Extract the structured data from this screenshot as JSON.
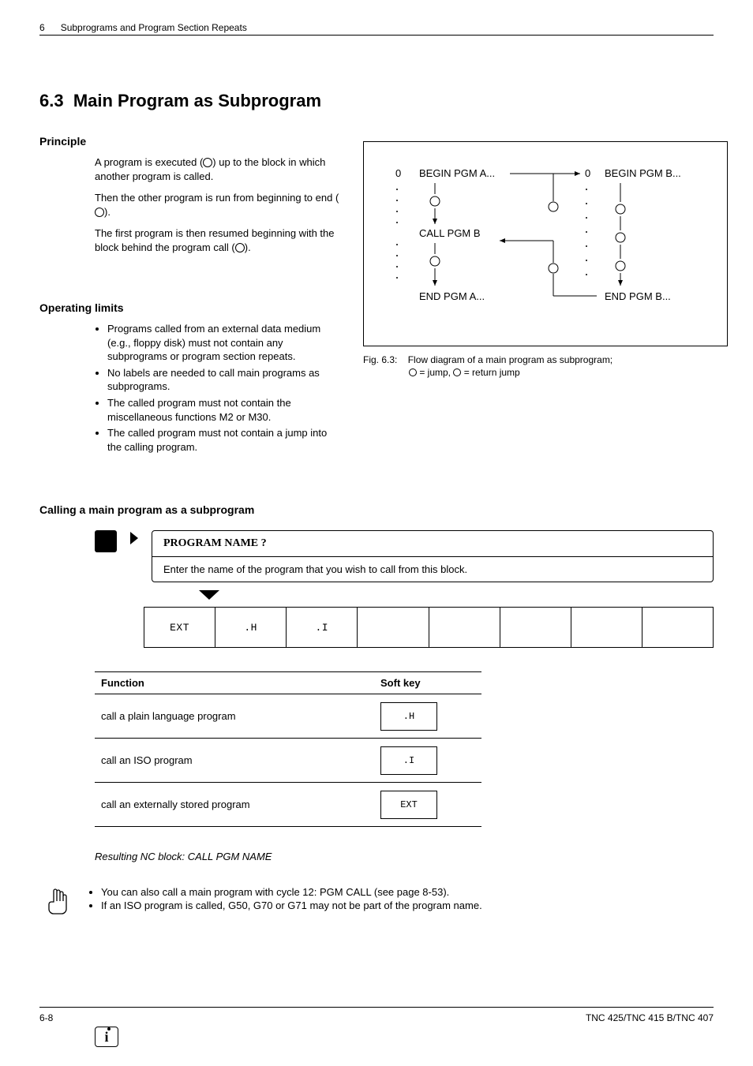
{
  "header": {
    "page_top": "6",
    "chapter": "Subprograms and Program Section Repeats"
  },
  "section": {
    "number": "6.3",
    "title": "Main Program as Subprogram"
  },
  "principle": {
    "heading": "Principle",
    "p1a": "A program is executed (",
    "p1b": ") up to the block in which another program is called.",
    "p2a": "Then the other program is run from beginning to end (",
    "p2b": ").",
    "p3a": "The first program is then resumed beginning with the block behind the program call (",
    "p3b": ")."
  },
  "limits": {
    "heading": "Operating limits",
    "items": [
      "Programs called from an external data medium (e.g., floppy disk) must not contain any subprograms or program section repeats.",
      "No labels are needed to call main programs as subprograms.",
      "The called program must not contain the miscellaneous functions M2 or M30.",
      "The called program must not contain a jump into the calling program."
    ]
  },
  "figure": {
    "left_0": "0",
    "begin_a": "BEGIN PGM A...",
    "call_b": "CALL PGM B",
    "end_a": "END PGM A...",
    "right_0": "0",
    "begin_b": "BEGIN PGM B...",
    "end_b": "END PGM B...",
    "caption_label": "Fig. 6.3:",
    "caption_text": "Flow diagram of a main program as subprogram;",
    "caption_sub_a": " = jump, ",
    "caption_sub_b": " = return jump"
  },
  "calling": {
    "heading": "Calling a main program as a subprogram",
    "prompt_head": "PROGRAM NAME ?",
    "prompt_body": "Enter the name of the program that you wish to call from this block.",
    "softkeys": [
      "EXT",
      ".H",
      ".I",
      "",
      "",
      "",
      "",
      ""
    ],
    "table": {
      "h1": "Function",
      "h2": "Soft key",
      "rows": [
        {
          "fn": "call a plain language program",
          "key": ".H"
        },
        {
          "fn": "call an ISO program",
          "key": ".I"
        },
        {
          "fn": "call an externally stored program",
          "key": "EXT"
        }
      ]
    },
    "resulting": "Resulting NC block: CALL PGM NAME"
  },
  "notes": {
    "items": [
      "You can also call a main program with cycle 12: PGM CALL (see page 8-53).",
      "If an ISO program is called, G50, G70 or G71 may not be part of the program name."
    ]
  },
  "footer": {
    "page": "6-8",
    "model": "TNC 425/TNC 415 B/TNC 407"
  }
}
